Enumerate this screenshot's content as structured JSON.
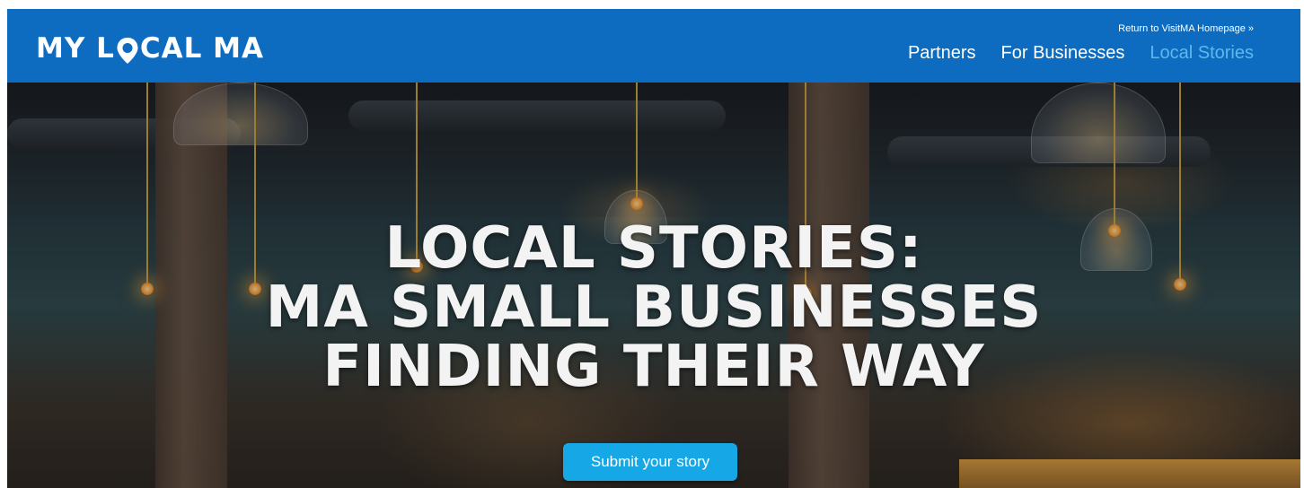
{
  "header": {
    "logo_text_left": "MY L",
    "logo_text_right": "CAL MA",
    "return_link": "Return to VisitMA Homepage »",
    "nav": [
      {
        "label": "Partners"
      },
      {
        "label": "For Businesses"
      },
      {
        "label": "Local Stories",
        "active": true
      }
    ],
    "background_color": "#0d6cc0",
    "active_nav_color": "#5fb7ee"
  },
  "hero": {
    "headline": {
      "line1": "LOCAL STORIES:",
      "line2": "MA SMALL BUSINESSES",
      "line3": "FINDING THEIR WAY"
    },
    "cta_label": "Submit your story",
    "cta_color": "#16a7e6"
  }
}
